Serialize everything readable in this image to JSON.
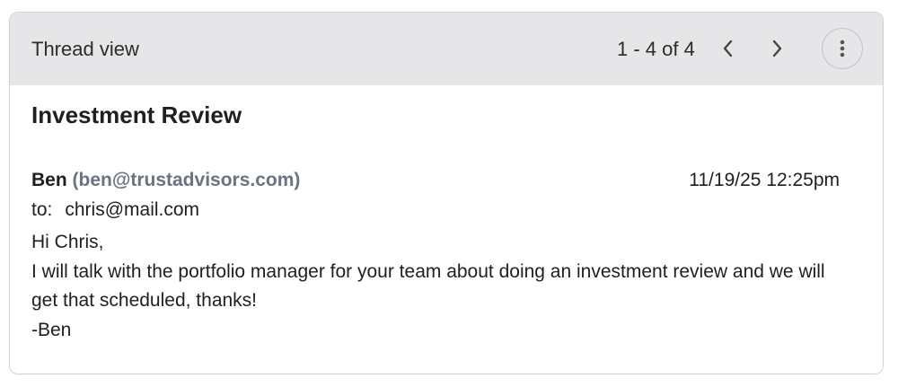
{
  "header": {
    "title": "Thread view",
    "pager": "1 - 4 of 4",
    "prev_icon": "chevron-left-icon",
    "next_icon": "chevron-right-icon",
    "more_icon": "more-vertical-icon"
  },
  "message": {
    "subject": "Investment Review",
    "sender_name": "Ben",
    "sender_email": "(ben@trustadvisors.com)",
    "timestamp": "11/19/25 12:25pm",
    "to_label": "to:",
    "to_value": "chris@mail.com",
    "body": [
      "Hi Chris,",
      "I will talk with the portfolio manager for your team about doing an investment review and we will get that scheduled, thanks!",
      "-Ben"
    ]
  },
  "colors": {
    "header_bg": "#e6e6e8",
    "email_gray": "#6b7280",
    "border": "#d2d2d6"
  }
}
